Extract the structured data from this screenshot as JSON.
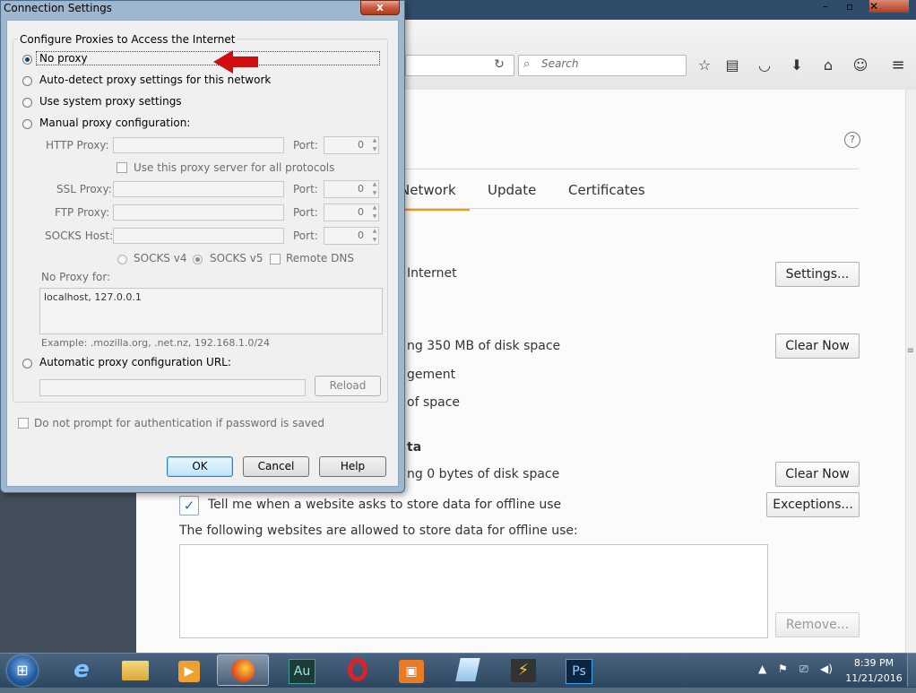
{
  "dialog": {
    "title": "Connection Settings",
    "close_label": "x",
    "group_title": "Configure Proxies to Access the Internet",
    "options": {
      "no_proxy": "No proxy",
      "auto_detect": "Auto-detect proxy settings for this network",
      "system": "Use system proxy settings",
      "manual": "Manual proxy configuration:",
      "auto_url": "Automatic proxy configuration URL:"
    },
    "selected_option": "no_proxy",
    "http_proxy_label": "HTTP Proxy:",
    "ssl_proxy_label": "SSL Proxy:",
    "ftp_proxy_label": "FTP Proxy:",
    "socks_host_label": "SOCKS Host:",
    "port_label": "Port:",
    "port_value": "0",
    "use_for_all_label": "Use this proxy server for all protocols",
    "socks_v4_label": "SOCKS v4",
    "socks_v5_label": "SOCKS v5",
    "remote_dns_label": "Remote DNS",
    "no_proxy_for_label": "No Proxy for:",
    "no_proxy_for_value": "localhost, 127.0.0.1",
    "example_text": "Example: .mozilla.org, .net.nz, 192.168.1.0/24",
    "reload_label": "Reload",
    "no_prompt_label": "Do not prompt for authentication if password is saved",
    "ok_label": "OK",
    "cancel_label": "Cancel",
    "help_label": "Help"
  },
  "browser": {
    "search_placeholder": "Search",
    "help_icon_text": "?",
    "tabs": {
      "network": "Network",
      "update": "Update",
      "certificates": "Certificates"
    },
    "connection_text": "Internet",
    "cached_text": "ng 350 MB of disk space",
    "override_text": "gement",
    "limit_text": "of space",
    "offline_heading": "ta",
    "offline_usage_text": "ng 0 bytes of disk space",
    "tell_me_label": "Tell me when a website asks to store data for offline use",
    "allowed_sites_label": "The following websites are allowed to store data for offline use:",
    "settings_button": "Settings...",
    "clear_now_button": "Clear Now",
    "exceptions_button": "Exceptions...",
    "remove_button": "Remove..."
  },
  "taskbar": {
    "time": "8:39 PM",
    "date": "11/21/2016",
    "apps": {
      "audition": "Au",
      "photoshop": "Ps"
    }
  },
  "colors": {
    "accent_tab": "#ff9500",
    "arrow": "#d01010",
    "dialog_frame": "#9fb6cf"
  }
}
